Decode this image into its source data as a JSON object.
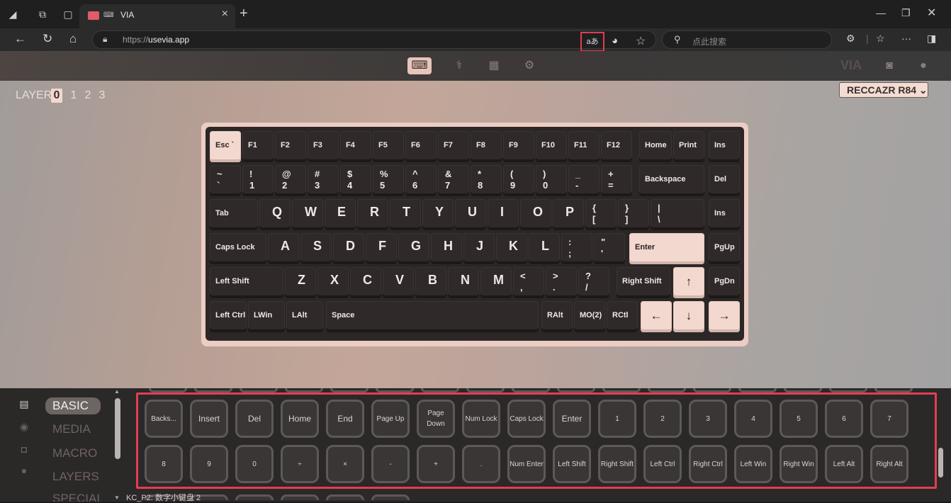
{
  "browser": {
    "tab_title": "VIA",
    "url_scheme": "https://",
    "url_host": "usevia.app",
    "read_aloud_label": "aあ",
    "search_placeholder": "点此搜索"
  },
  "app": {
    "layer_label": "LAYER",
    "layers": [
      "0",
      "1",
      "2",
      "3"
    ],
    "active_layer": "0",
    "device_name": "RECCAZR R84",
    "brand": "VIA"
  },
  "keyboard": {
    "row1": [
      "Esc `",
      "F1",
      "F2",
      "F3",
      "F4",
      "F5",
      "F6",
      "F7",
      "F8",
      "F9",
      "F10",
      "F11",
      "F12",
      "Home",
      "Print",
      "Ins"
    ],
    "row2": [
      {
        "top": "~",
        "bot": "`"
      },
      {
        "top": "!",
        "bot": "1"
      },
      {
        "top": "@",
        "bot": "2"
      },
      {
        "top": "#",
        "bot": "3"
      },
      {
        "top": "$",
        "bot": "4"
      },
      {
        "top": "%",
        "bot": "5"
      },
      {
        "top": "^",
        "bot": "6"
      },
      {
        "top": "&",
        "bot": "7"
      },
      {
        "top": "*",
        "bot": "8"
      },
      {
        "top": "(",
        "bot": "9"
      },
      {
        "top": ")",
        "bot": "0"
      },
      {
        "top": "_",
        "bot": "-"
      },
      {
        "top": "+",
        "bot": "="
      }
    ],
    "row2_backspace": "Backspace",
    "row2_del": "Del",
    "row3_tab": "Tab",
    "row3_letters": [
      "Q",
      "W",
      "E",
      "R",
      "T",
      "Y",
      "U",
      "I",
      "O",
      "P"
    ],
    "row3_sym": [
      {
        "top": "{",
        "bot": "["
      },
      {
        "top": "}",
        "bot": "]"
      },
      {
        "top": "|",
        "bot": "\\"
      }
    ],
    "row3_ins": "Ins",
    "row4_caps": "Caps Lock",
    "row4_letters": [
      "A",
      "S",
      "D",
      "F",
      "G",
      "H",
      "J",
      "K",
      "L"
    ],
    "row4_sym": [
      {
        "top": ":",
        "bot": ";"
      },
      {
        "top": "\"",
        "bot": "'"
      }
    ],
    "row4_enter": "Enter",
    "row4_pgup": "PgUp",
    "row5_lshift": "Left Shift",
    "row5_letters": [
      "Z",
      "X",
      "C",
      "V",
      "B",
      "N",
      "M"
    ],
    "row5_sym": [
      {
        "top": "<",
        "bot": ","
      },
      {
        "top": ">",
        "bot": "."
      },
      {
        "top": "?",
        "bot": "/"
      }
    ],
    "row5_rshift": "Right Shift",
    "row5_up": "↑",
    "row5_pgdn": "PgDn",
    "row6": {
      "lctrl": "Left Ctrl",
      "lwin": "LWin",
      "lalt": "LAlt",
      "space": "Space",
      "ralt": "RAlt",
      "mo2": "MO(2)",
      "rctl": "RCtl",
      "left": "←",
      "down": "↓",
      "right": "→"
    }
  },
  "bottom": {
    "categories": [
      "BASIC",
      "MEDIA",
      "MACRO",
      "LAYERS",
      "SPECIAL"
    ],
    "keys_row1": [
      "Backs...",
      "Insert",
      "Del",
      "Home",
      "End",
      "Page Up",
      "Page Down",
      "Num Lock",
      "Caps Lock",
      "Enter",
      "1",
      "2",
      "3",
      "4",
      "5",
      "6",
      "7"
    ],
    "keys_row2": [
      "8",
      "9",
      "0",
      "÷",
      "×",
      "-",
      "+",
      ".",
      "Num Enter",
      "Left Shift",
      "Right Shift",
      "Left Ctrl",
      "Right Ctrl",
      "Left Win",
      "Right Win",
      "Left Alt",
      "Right Alt"
    ],
    "hover_label": "KC_P2: 数字小键盘 2"
  }
}
